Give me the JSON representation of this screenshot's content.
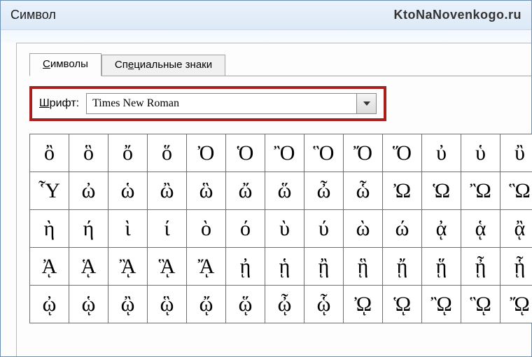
{
  "window": {
    "title": "Символ",
    "watermark": "KtoNaNovenkogo.ru"
  },
  "tabs": {
    "symbols": "Символы",
    "special": "Специальные знаки"
  },
  "font": {
    "label_prefix_ul": "Ш",
    "label_rest": "рифт:",
    "value": "Times New Roman"
  },
  "grid": [
    [
      "ὂ",
      "ὃ",
      "ὄ",
      "ὅ",
      "Ὀ",
      "Ὁ",
      "Ὂ",
      "Ὃ",
      "Ὄ",
      "Ὅ",
      "ὐ",
      "ὑ",
      "ὒ"
    ],
    [
      "Ὗ",
      "ὠ",
      "ὡ",
      "ὢ",
      "ὣ",
      "ὤ",
      "ὥ",
      "ὦ",
      "ὧ",
      "Ὠ",
      "Ὡ",
      "Ὢ",
      "Ὣ"
    ],
    [
      "ὴ",
      "ή",
      "ὶ",
      "ί",
      "ὸ",
      "ό",
      "ὺ",
      "ύ",
      "ὼ",
      "ώ",
      "ᾀ",
      "ᾁ",
      "ᾂ"
    ],
    [
      "ᾈ",
      "ᾉ",
      "ᾊ",
      "ᾋ",
      "ᾌ",
      "ᾐ",
      "ᾑ",
      "ᾒ",
      "ᾓ",
      "ᾔ",
      "ᾕ",
      "ᾖ",
      "ᾗ"
    ],
    [
      "ᾠ",
      "ᾡ",
      "ᾢ",
      "ᾣ",
      "ᾤ",
      "ᾥ",
      "ᾦ",
      "ᾧ",
      "ᾨ",
      "ᾩ",
      "ᾪ",
      "ᾫ",
      "ᾬ"
    ]
  ]
}
